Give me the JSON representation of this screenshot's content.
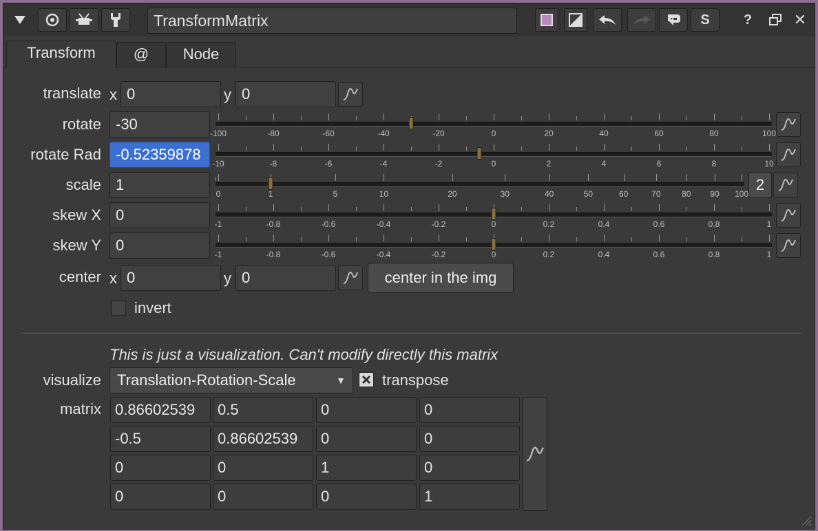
{
  "title_bar": {
    "node_name": "TransformMatrix",
    "help_label": "?",
    "close_label": "✕",
    "script_label": "S"
  },
  "tabs": [
    {
      "label": "Transform",
      "active": true
    },
    {
      "label": "@",
      "active": false
    },
    {
      "label": "Node",
      "active": false
    }
  ],
  "params": {
    "translate": {
      "label": "translate",
      "x_label": "x",
      "y_label": "y",
      "x": "0",
      "y": "0"
    },
    "rotate": {
      "label": "rotate",
      "value": "-30",
      "ticks": [
        "-100",
        "-80",
        "-60",
        "-40",
        "-20",
        "0",
        "20",
        "40",
        "60",
        "80",
        "100"
      ]
    },
    "rotate_rad": {
      "label": "rotate Rad",
      "value": "-0.52359878",
      "ticks": [
        "-10",
        "-8",
        "-6",
        "-4",
        "-2",
        "0",
        "2",
        "4",
        "6",
        "8",
        "10"
      ]
    },
    "scale": {
      "label": "scale",
      "value": "1",
      "channels_label": "2",
      "ticks": [
        "0",
        "1",
        "5",
        "10",
        "20",
        "30",
        "40",
        "50",
        "60",
        "70",
        "80",
        "90",
        "100"
      ]
    },
    "skew_x": {
      "label": "skew X",
      "value": "0",
      "ticks": [
        "-1",
        "-0.8",
        "-0.6",
        "-0.4",
        "-0.2",
        "0",
        "0.2",
        "0.4",
        "0.6",
        "0.8",
        "1"
      ]
    },
    "skew_y": {
      "label": "skew Y",
      "value": "0",
      "ticks": [
        "-1",
        "-0.8",
        "-0.6",
        "-0.4",
        "-0.2",
        "0",
        "0.2",
        "0.4",
        "0.6",
        "0.8",
        "1"
      ]
    },
    "center": {
      "label": "center",
      "x_label": "x",
      "y_label": "y",
      "x": "0",
      "y": "0",
      "button_label": "center in the img"
    },
    "invert": {
      "label": "invert",
      "checked": false
    }
  },
  "visualize": {
    "hint": "This is just a visualization. Can't modify directly this matrix",
    "label": "visualize",
    "selected": "Translation-Rotation-Scale",
    "transpose_label": "transpose",
    "transpose_checked": true
  },
  "matrix": {
    "label": "matrix",
    "rows": [
      [
        "0.86602539",
        "0.5",
        "0",
        "0"
      ],
      [
        "-0.5",
        "0.86602539",
        "0",
        "0"
      ],
      [
        "0",
        "0",
        "1",
        "0"
      ],
      [
        "0",
        "0",
        "0",
        "1"
      ]
    ]
  },
  "colors": {
    "selection": "#3b6fd1",
    "slider_handle": "#8b6f3b",
    "window_border": "#8a6f8f"
  }
}
